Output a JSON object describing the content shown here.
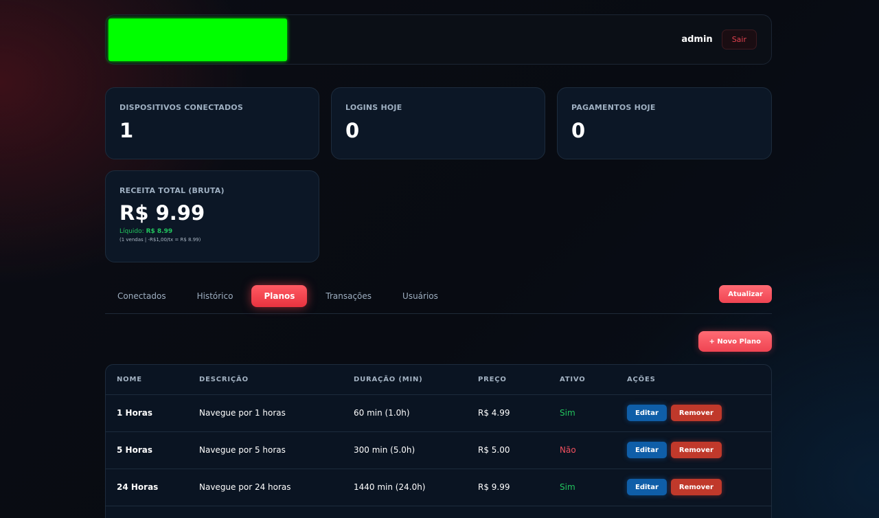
{
  "header": {
    "user_name": "admin",
    "logout_label": "Sair"
  },
  "stats": [
    {
      "label": "DISPOSITIVOS CONECTADOS",
      "value": "1"
    },
    {
      "label": "LOGINS HOJE",
      "value": "0"
    },
    {
      "label": "PAGAMENTOS HOJE",
      "value": "0"
    }
  ],
  "revenue": {
    "label": "RECEITA TOTAL (BRUTA)",
    "value": "R$ 9.99",
    "net_label": "Líquido:",
    "net_value": "R$ 8.99",
    "fee_note": "(1 vendas | -R$1,00/tx = R$ 8.99)"
  },
  "tabs": [
    "Conectados",
    "Histórico",
    "Planos",
    "Transações",
    "Usuários"
  ],
  "active_tab": "Planos",
  "refresh_label": "Atualizar",
  "new_plan_label": "+ Novo Plano",
  "table": {
    "headers": [
      "NOME",
      "DESCRIÇÃO",
      "DURAÇÃO (MIN)",
      "PREÇO",
      "ATIVO",
      "AÇÕES"
    ],
    "rows": [
      {
        "name": "1 Horas",
        "description": "Navegue por 1 horas",
        "duration": "60 min (1.0h)",
        "price": "R$ 4.99",
        "active": "Sim"
      },
      {
        "name": "5 Horas",
        "description": "Navegue por 5 horas",
        "duration": "300 min (5.0h)",
        "price": "R$ 5.00",
        "active": "Não"
      },
      {
        "name": "24 Horas",
        "description": "Navegue por 24 horas",
        "duration": "1440 min (24.0h)",
        "price": "R$ 9.99",
        "active": "Sim"
      }
    ],
    "edit_label": "Editar",
    "remove_label": "Remover"
  },
  "colors": {
    "accent": "#ef4452",
    "active_yes": "#22c55e",
    "active_no": "#f0505f",
    "edit_button": "#0f5ea8",
    "remove_button": "#c0392b",
    "logo_placeholder": "#00ff00"
  }
}
